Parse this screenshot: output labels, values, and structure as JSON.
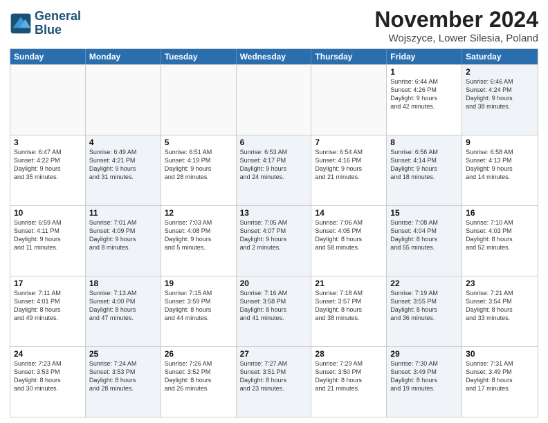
{
  "header": {
    "logo_line1": "General",
    "logo_line2": "Blue",
    "title": "November 2024",
    "subtitle": "Wojszyce, Lower Silesia, Poland"
  },
  "days_of_week": [
    "Sunday",
    "Monday",
    "Tuesday",
    "Wednesday",
    "Thursday",
    "Friday",
    "Saturday"
  ],
  "rows": [
    [
      {
        "day": "",
        "info": "",
        "shaded": false,
        "empty": true
      },
      {
        "day": "",
        "info": "",
        "shaded": false,
        "empty": true
      },
      {
        "day": "",
        "info": "",
        "shaded": false,
        "empty": true
      },
      {
        "day": "",
        "info": "",
        "shaded": false,
        "empty": true
      },
      {
        "day": "",
        "info": "",
        "shaded": false,
        "empty": true
      },
      {
        "day": "1",
        "info": "Sunrise: 6:44 AM\nSunset: 4:26 PM\nDaylight: 9 hours\nand 42 minutes.",
        "shaded": false,
        "empty": false
      },
      {
        "day": "2",
        "info": "Sunrise: 6:46 AM\nSunset: 4:24 PM\nDaylight: 9 hours\nand 38 minutes.",
        "shaded": true,
        "empty": false
      }
    ],
    [
      {
        "day": "3",
        "info": "Sunrise: 6:47 AM\nSunset: 4:22 PM\nDaylight: 9 hours\nand 35 minutes.",
        "shaded": false,
        "empty": false
      },
      {
        "day": "4",
        "info": "Sunrise: 6:49 AM\nSunset: 4:21 PM\nDaylight: 9 hours\nand 31 minutes.",
        "shaded": true,
        "empty": false
      },
      {
        "day": "5",
        "info": "Sunrise: 6:51 AM\nSunset: 4:19 PM\nDaylight: 9 hours\nand 28 minutes.",
        "shaded": false,
        "empty": false
      },
      {
        "day": "6",
        "info": "Sunrise: 6:53 AM\nSunset: 4:17 PM\nDaylight: 9 hours\nand 24 minutes.",
        "shaded": true,
        "empty": false
      },
      {
        "day": "7",
        "info": "Sunrise: 6:54 AM\nSunset: 4:16 PM\nDaylight: 9 hours\nand 21 minutes.",
        "shaded": false,
        "empty": false
      },
      {
        "day": "8",
        "info": "Sunrise: 6:56 AM\nSunset: 4:14 PM\nDaylight: 9 hours\nand 18 minutes.",
        "shaded": true,
        "empty": false
      },
      {
        "day": "9",
        "info": "Sunrise: 6:58 AM\nSunset: 4:13 PM\nDaylight: 9 hours\nand 14 minutes.",
        "shaded": false,
        "empty": false
      }
    ],
    [
      {
        "day": "10",
        "info": "Sunrise: 6:59 AM\nSunset: 4:11 PM\nDaylight: 9 hours\nand 11 minutes.",
        "shaded": false,
        "empty": false
      },
      {
        "day": "11",
        "info": "Sunrise: 7:01 AM\nSunset: 4:09 PM\nDaylight: 9 hours\nand 8 minutes.",
        "shaded": true,
        "empty": false
      },
      {
        "day": "12",
        "info": "Sunrise: 7:03 AM\nSunset: 4:08 PM\nDaylight: 9 hours\nand 5 minutes.",
        "shaded": false,
        "empty": false
      },
      {
        "day": "13",
        "info": "Sunrise: 7:05 AM\nSunset: 4:07 PM\nDaylight: 9 hours\nand 2 minutes.",
        "shaded": true,
        "empty": false
      },
      {
        "day": "14",
        "info": "Sunrise: 7:06 AM\nSunset: 4:05 PM\nDaylight: 8 hours\nand 58 minutes.",
        "shaded": false,
        "empty": false
      },
      {
        "day": "15",
        "info": "Sunrise: 7:08 AM\nSunset: 4:04 PM\nDaylight: 8 hours\nand 55 minutes.",
        "shaded": true,
        "empty": false
      },
      {
        "day": "16",
        "info": "Sunrise: 7:10 AM\nSunset: 4:03 PM\nDaylight: 8 hours\nand 52 minutes.",
        "shaded": false,
        "empty": false
      }
    ],
    [
      {
        "day": "17",
        "info": "Sunrise: 7:11 AM\nSunset: 4:01 PM\nDaylight: 8 hours\nand 49 minutes.",
        "shaded": false,
        "empty": false
      },
      {
        "day": "18",
        "info": "Sunrise: 7:13 AM\nSunset: 4:00 PM\nDaylight: 8 hours\nand 47 minutes.",
        "shaded": true,
        "empty": false
      },
      {
        "day": "19",
        "info": "Sunrise: 7:15 AM\nSunset: 3:59 PM\nDaylight: 8 hours\nand 44 minutes.",
        "shaded": false,
        "empty": false
      },
      {
        "day": "20",
        "info": "Sunrise: 7:16 AM\nSunset: 3:58 PM\nDaylight: 8 hours\nand 41 minutes.",
        "shaded": true,
        "empty": false
      },
      {
        "day": "21",
        "info": "Sunrise: 7:18 AM\nSunset: 3:57 PM\nDaylight: 8 hours\nand 38 minutes.",
        "shaded": false,
        "empty": false
      },
      {
        "day": "22",
        "info": "Sunrise: 7:19 AM\nSunset: 3:55 PM\nDaylight: 8 hours\nand 36 minutes.",
        "shaded": true,
        "empty": false
      },
      {
        "day": "23",
        "info": "Sunrise: 7:21 AM\nSunset: 3:54 PM\nDaylight: 8 hours\nand 33 minutes.",
        "shaded": false,
        "empty": false
      }
    ],
    [
      {
        "day": "24",
        "info": "Sunrise: 7:23 AM\nSunset: 3:53 PM\nDaylight: 8 hours\nand 30 minutes.",
        "shaded": false,
        "empty": false
      },
      {
        "day": "25",
        "info": "Sunrise: 7:24 AM\nSunset: 3:53 PM\nDaylight: 8 hours\nand 28 minutes.",
        "shaded": true,
        "empty": false
      },
      {
        "day": "26",
        "info": "Sunrise: 7:26 AM\nSunset: 3:52 PM\nDaylight: 8 hours\nand 26 minutes.",
        "shaded": false,
        "empty": false
      },
      {
        "day": "27",
        "info": "Sunrise: 7:27 AM\nSunset: 3:51 PM\nDaylight: 8 hours\nand 23 minutes.",
        "shaded": true,
        "empty": false
      },
      {
        "day": "28",
        "info": "Sunrise: 7:29 AM\nSunset: 3:50 PM\nDaylight: 8 hours\nand 21 minutes.",
        "shaded": false,
        "empty": false
      },
      {
        "day": "29",
        "info": "Sunrise: 7:30 AM\nSunset: 3:49 PM\nDaylight: 8 hours\nand 19 minutes.",
        "shaded": true,
        "empty": false
      },
      {
        "day": "30",
        "info": "Sunrise: 7:31 AM\nSunset: 3:49 PM\nDaylight: 8 hours\nand 17 minutes.",
        "shaded": false,
        "empty": false
      }
    ]
  ]
}
